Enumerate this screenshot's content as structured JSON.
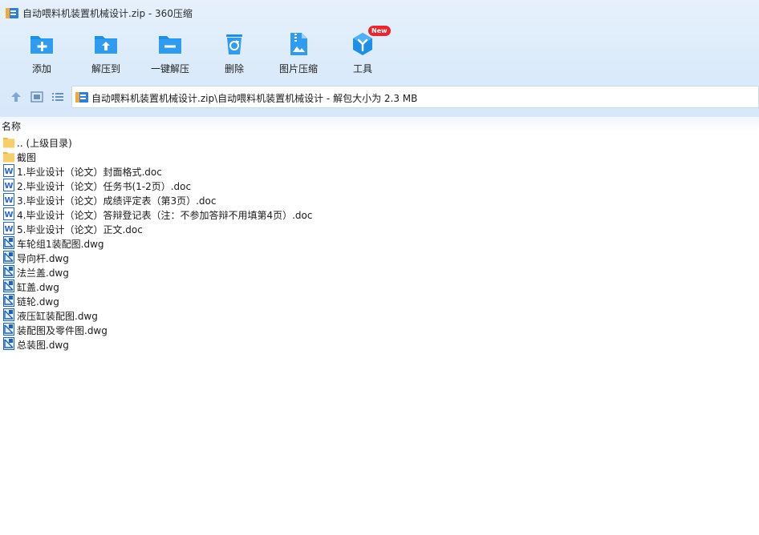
{
  "window": {
    "title": "自动喂料机装置机械设计.zip - 360压缩",
    "icon": "archive-icon"
  },
  "toolbar": {
    "items": [
      {
        "label": "添加",
        "icon": "add-folder-icon"
      },
      {
        "label": "解压到",
        "icon": "extract-to-icon"
      },
      {
        "label": "一键解压",
        "icon": "one-click-extract-icon"
      },
      {
        "label": "删除",
        "icon": "recycle-bin-icon"
      },
      {
        "label": "图片压缩",
        "icon": "image-compress-icon"
      },
      {
        "label": "工具",
        "icon": "tools-icon",
        "badge": "New"
      }
    ]
  },
  "nav": {
    "path": "自动喂料机装置机械设计.zip\\自动喂料机装置机械设计 - 解包大小为 2.3 MB"
  },
  "list": {
    "column_name": "名称",
    "files": [
      {
        "name": ".. (上级目录)",
        "type": "folder"
      },
      {
        "name": "截图",
        "type": "folder"
      },
      {
        "name": "1.毕业设计（论文）封面格式.doc",
        "type": "doc"
      },
      {
        "name": "2.毕业设计（论文）任务书(1-2页）.doc",
        "type": "doc"
      },
      {
        "name": "3.毕业设计（论文）成绩评定表（第3页）.doc",
        "type": "doc"
      },
      {
        "name": "4.毕业设计（论文）答辩登记表（注：不参加答辩不用填第4页）.doc",
        "type": "doc"
      },
      {
        "name": "5.毕业设计（论文）正文.doc",
        "type": "doc"
      },
      {
        "name": "车轮组1装配图.dwg",
        "type": "dwg"
      },
      {
        "name": "导向杆.dwg",
        "type": "dwg"
      },
      {
        "name": "法兰盖.dwg",
        "type": "dwg"
      },
      {
        "name": "缸盖.dwg",
        "type": "dwg"
      },
      {
        "name": "链轮.dwg",
        "type": "dwg"
      },
      {
        "name": "液压缸装配图.dwg",
        "type": "dwg"
      },
      {
        "name": "装配图及零件图.dwg",
        "type": "dwg"
      },
      {
        "name": "总装图.dwg",
        "type": "dwg"
      }
    ]
  },
  "colors": {
    "accent": "#1e8fe6",
    "folder": "#f7cf6a",
    "doc": "#2b64c8",
    "dwg": "#1b62b8",
    "badge": "#e8262d"
  }
}
